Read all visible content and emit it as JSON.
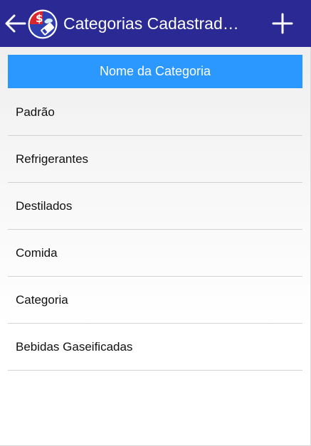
{
  "app_bar": {
    "title": "Categorias Cadastrad…",
    "background_color": "#2b2a94",
    "back_icon": "arrow-left-icon",
    "logo_icon": "app-logo-icon",
    "add_icon": "plus-icon"
  },
  "table_header": {
    "label": "Nome da Categoria",
    "background_color": "#2a98ff"
  },
  "categories": [
    {
      "label": "Padrão"
    },
    {
      "label": "Refrigerantes"
    },
    {
      "label": "Destilados"
    },
    {
      "label": "Comida"
    },
    {
      "label": "Categoria"
    },
    {
      "label": "Bebidas Gaseificadas"
    }
  ]
}
